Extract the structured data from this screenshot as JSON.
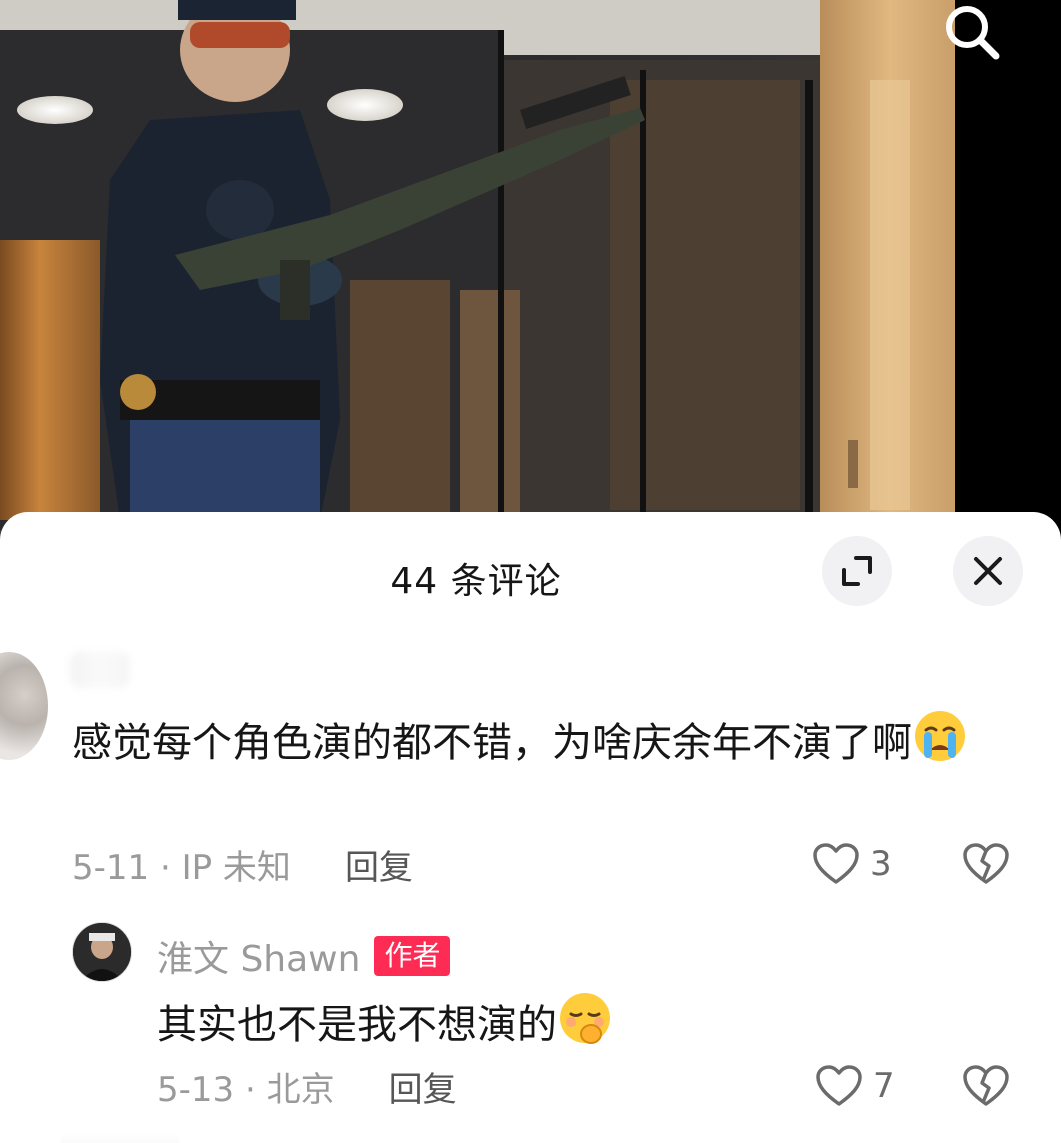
{
  "video": {
    "search_icon": "search-icon"
  },
  "sheet": {
    "title": "44 条评论",
    "expand_icon": "expand-icon",
    "close_icon": "close-icon"
  },
  "comments": [
    {
      "text": "感觉每个角色演的都不错，为啥庆余年不演了啊",
      "emoji": "crying-face-emoji",
      "meta": "5-11 · IP 未知",
      "reply_label": "回复",
      "likes": "3"
    }
  ],
  "replies": [
    {
      "author": "淮文 Shawn",
      "badge": "作者",
      "text": "其实也不是我不想演的",
      "emoji": "shushing-face-emoji",
      "meta": "5-13 · 北京",
      "reply_label": "回复",
      "likes": "7"
    }
  ],
  "colors": {
    "badge": "#fe2c55",
    "text": "#161616",
    "muted": "#9a9a9a"
  }
}
